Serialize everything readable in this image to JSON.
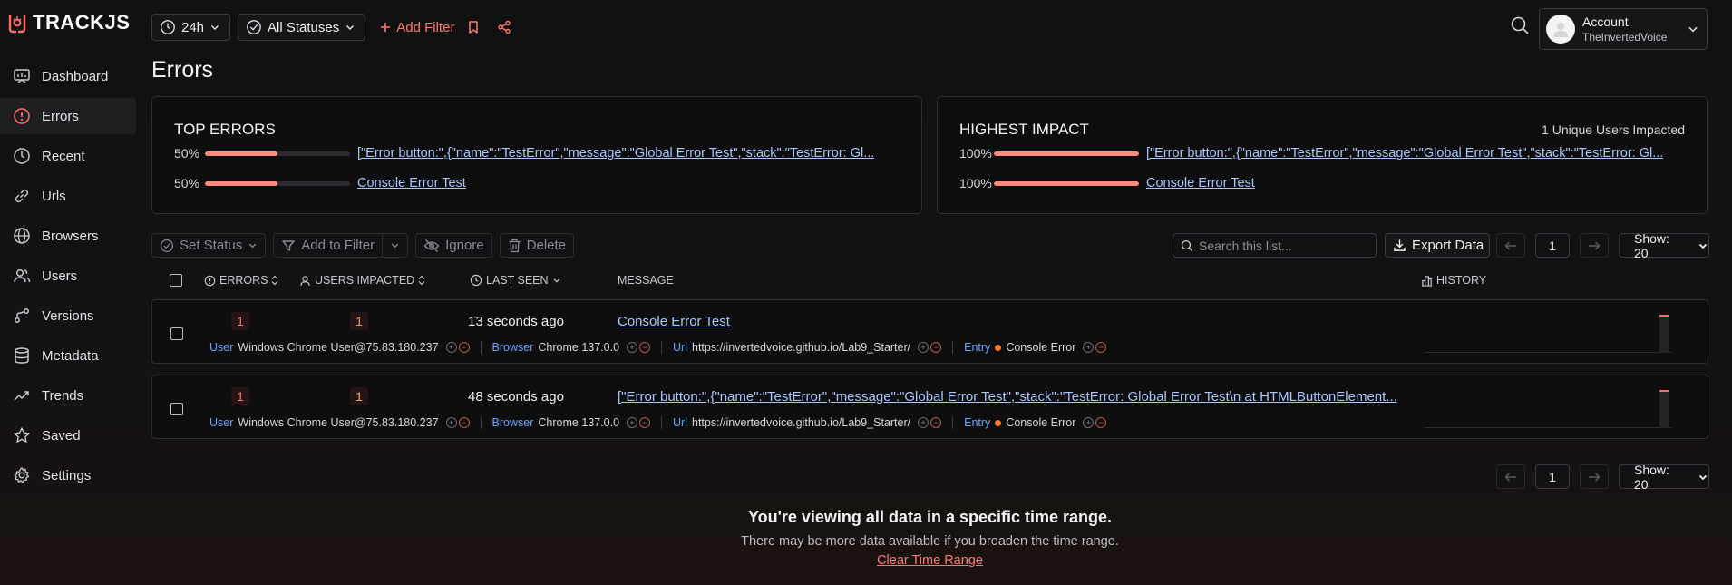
{
  "app": {
    "logo_text": "TRACKJS"
  },
  "sidebar": {
    "items": [
      {
        "label": "Dashboard",
        "icon": "dashboard-icon"
      },
      {
        "label": "Errors",
        "icon": "alert-circle-icon",
        "active": true
      },
      {
        "label": "Recent",
        "icon": "clock-icon"
      },
      {
        "label": "Urls",
        "icon": "link-icon"
      },
      {
        "label": "Browsers",
        "icon": "globe-icon"
      },
      {
        "label": "Users",
        "icon": "users-icon"
      },
      {
        "label": "Versions",
        "icon": "branch-icon"
      },
      {
        "label": "Metadata",
        "icon": "database-icon"
      },
      {
        "label": "Trends",
        "icon": "trend-icon"
      },
      {
        "label": "Saved",
        "icon": "star-icon"
      },
      {
        "label": "Settings",
        "icon": "gear-icon"
      }
    ]
  },
  "topbar": {
    "time_range": "24h",
    "status_filter": "All Statuses",
    "add_filter": "Add Filter"
  },
  "account": {
    "name": "Account",
    "username": "TheInvertedVoice"
  },
  "page": {
    "title": "Errors"
  },
  "top_errors": {
    "title": "TOP ERRORS",
    "rows": [
      {
        "pct_label": "50%",
        "pct": 0.5,
        "label": "[\"Error button:\",{\"name\":\"TestError\",\"message\":\"Global Error Test\",\"stack\":\"TestError: Gl..."
      },
      {
        "pct_label": "50%",
        "pct": 0.5,
        "label": "Console Error Test"
      }
    ]
  },
  "highest_impact": {
    "title": "HIGHEST IMPACT",
    "subtitle": "1 Unique Users Impacted",
    "rows": [
      {
        "pct_label": "100%",
        "pct": 1.0,
        "label": "[\"Error button:\",{\"name\":\"TestError\",\"message\":\"Global Error Test\",\"stack\":\"TestError: Gl..."
      },
      {
        "pct_label": "100%",
        "pct": 1.0,
        "label": "Console Error Test"
      }
    ]
  },
  "toolbar": {
    "set_status": "Set Status",
    "add_to_filter": "Add to Filter",
    "ignore": "Ignore",
    "delete": "Delete",
    "search_placeholder": "Search this list...",
    "export": "Export Data",
    "page": "1",
    "show": "Show: 20"
  },
  "table": {
    "headers": {
      "errors": "ERRORS",
      "users_impacted": "USERS IMPACTED",
      "last_seen": "LAST SEEN",
      "message": "MESSAGE",
      "history": "HISTORY"
    },
    "meta_keys": {
      "user": "User",
      "browser": "Browser",
      "url": "Url",
      "entry": "Entry"
    },
    "rows": [
      {
        "errors": "1",
        "users": "1",
        "last_seen": "13 seconds ago",
        "message": "Console Error Test",
        "user": "Windows Chrome User@75.83.180.237",
        "browser": "Chrome 137.0.0",
        "url": "https://invertedvoice.github.io/Lab9_Starter/",
        "entry": "Console Error"
      },
      {
        "errors": "1",
        "users": "1",
        "last_seen": "48 seconds ago",
        "message": "[\"Error button:\",{\"name\":\"TestError\",\"message\":\"Global Error Test\",\"stack\":\"TestError: Global Error Test\\n at HTMLButtonElement...",
        "user": "Windows Chrome User@75.83.180.237",
        "browser": "Chrome 137.0.0",
        "url": "https://invertedvoice.github.io/Lab9_Starter/",
        "entry": "Console Error"
      }
    ]
  },
  "footer": {
    "heading": "You're viewing all data in a specific time range.",
    "text": "There may be more data available if you broaden the time range.",
    "link": "Clear Time Range"
  },
  "colors": {
    "accent": "#ff7a6e",
    "link": "#a9c6ff",
    "bar": "#ff8a80",
    "meta_key": "#6aa2ff"
  }
}
